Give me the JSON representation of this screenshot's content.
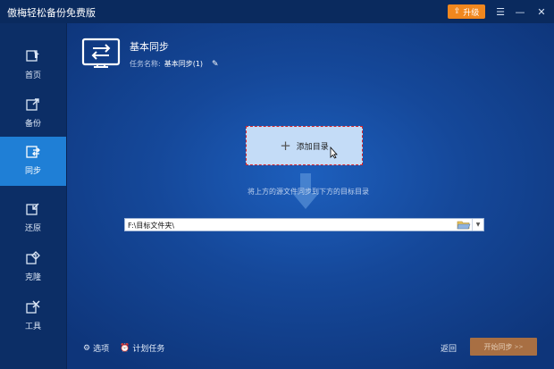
{
  "app": {
    "title": "傲梅轻松备份免费版"
  },
  "titlebar": {
    "upgrade_label": "升级",
    "menu_icon": "menu-icon",
    "minimize_icon": "minimize-icon",
    "close_icon": "close-icon"
  },
  "sidebar": {
    "items": [
      {
        "label": "首页",
        "icon": "home-icon",
        "active": false
      },
      {
        "label": "备份",
        "icon": "backup-icon",
        "active": false
      },
      {
        "label": "同步",
        "icon": "sync-icon",
        "active": true
      },
      {
        "label": "还原",
        "icon": "restore-icon",
        "active": false
      },
      {
        "label": "克隆",
        "icon": "clone-icon",
        "active": false
      },
      {
        "label": "工具",
        "icon": "tools-icon",
        "active": false
      }
    ]
  },
  "header": {
    "title": "基本同步",
    "task_label": "任务名称:",
    "task_value": "基本同步(1)"
  },
  "source": {
    "add_label": "添加目录"
  },
  "hint": "将上方的源文件同步到下方的目标目录",
  "target": {
    "path": "F:\\目标文件夹\\"
  },
  "footer": {
    "options_label": "选项",
    "schedule_label": "计划任务",
    "back_label": "返回",
    "start_label": "开始同步",
    "start_suffix": ">>"
  },
  "colors": {
    "accent": "#1f7fd6",
    "upgrade": "#f0871e",
    "start_button": "#a86f43"
  }
}
